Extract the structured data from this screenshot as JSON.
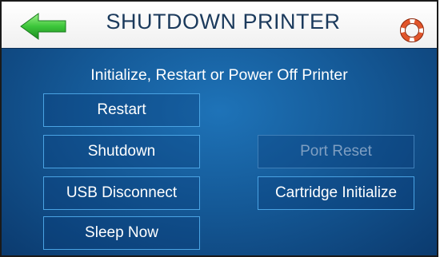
{
  "header": {
    "title": "SHUTDOWN PRINTER",
    "back_icon": "back-arrow-icon",
    "help_icon": "lifebuoy-help-icon",
    "accent_green": "#39c44a",
    "title_color": "#1b3a5c"
  },
  "main": {
    "subtitle": "Initialize, Restart or Power Off Printer",
    "buttons": {
      "restart": "Restart",
      "shutdown": "Shutdown",
      "usb_disconnect": "USB Disconnect",
      "sleep_now": "Sleep Now",
      "port_reset": "Port Reset",
      "cartridge_initialize": "Cartridge Initialize"
    },
    "disabled": [
      "port_reset"
    ],
    "background_color": "#155a98",
    "button_border_color": "#4aa3e3"
  }
}
